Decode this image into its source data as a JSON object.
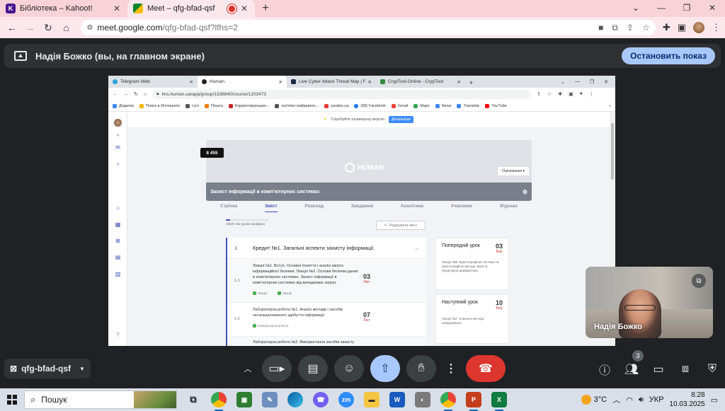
{
  "browser": {
    "tabs": [
      {
        "title": "Бібліотека – Kahoot!",
        "icon": "kahoot-icon",
        "color": "#46178f"
      },
      {
        "title": "Meet – qfg-bfad-qsf",
        "icon": "meet-icon",
        "active": true
      }
    ],
    "url_host": "meet.google.com",
    "url_path": "/qfg-bfad-qsf?lfhs=2"
  },
  "banner": {
    "text": "Надія Божко (вы, на главном экране)",
    "stop_label": "Остановить показ"
  },
  "shared": {
    "tabs": [
      "Telegram Web",
      "Human",
      "Live Cyber Attack Threat Map | R",
      "CrypTool-Online - CrypTool"
    ],
    "url": "lms.human.ua/app/group/1338840/course/1203473",
    "bookmarks": [
      "Додатки",
      "Поиск в Интернете",
      "гугл",
      "Пошта",
      "Корректирующая...",
      "summer-wallpapers...",
      "yandex.ua",
      "(58) Facebook",
      "Gmail",
      "Maps",
      "News",
      "Translate",
      "YouTube"
    ],
    "promo": "Спробуйте розширену версію",
    "promo_button": "Детальніше",
    "points": "8 455",
    "brand": "HUMAN",
    "rating_dropdown": "Оцінювання",
    "course_title": "Захист інформації в комп'ютерних системах",
    "course_tabs": [
      "Стрічка",
      "Зміст",
      "Розклад",
      "Завдання",
      "Аналітика",
      "Учасники",
      "Журнал"
    ],
    "progress_text": "10/20 тем уроків пройдено",
    "progress": 0.1,
    "edit_button": "Редагувати зміст",
    "credit_num": "1",
    "credit_title": "Кредит №1. Загальні аспекти захисту інформації.",
    "lessons": [
      {
        "num": "1.1",
        "text": "Лекція №1. Вступ. Основні поняття і аналіз загроз інформаційної безпеки. Лекція №2. Основи безпеки даних в комп'ютерних системах. Захист інформації в комп'ютерних системах від випадкових загроз",
        "tag1": "Лекція",
        "tag2": "Лекція",
        "day": "03",
        "month": "Лют"
      },
      {
        "num": "1.2",
        "text": "Лабораторна робота №1. Аналіз методів і засобів несанкціонованого здобуття інформації",
        "tag1": "Лабораторна робота",
        "tag2": "",
        "day": "07",
        "month": "Лют"
      },
      {
        "num": "1.3",
        "text": "Лабораторна робота №2. Використання засобів захисту",
        "tag1": "",
        "tag2": "",
        "day": "",
        "month": ""
      }
    ],
    "prev_card": {
      "title": "Попередній урок",
      "day": "03",
      "month": "Бер",
      "body": "Лекція №6. Криптографічні системи та криптографічні методи захисту. Модулярна арифметика."
    },
    "next_card": {
      "title": "Наступний урок",
      "day": "10",
      "month": "Бер",
      "body": "Лекція №7. Класичні методи шифрування."
    }
  },
  "self_tile": {
    "name": "Надія Божко"
  },
  "meet": {
    "code": "qfg-bfad-qsf",
    "participants": "3"
  },
  "taskbar": {
    "search_label": "Пошук",
    "weather": "3°C",
    "lang": "УКР",
    "time": "8:28",
    "date": "10.03.2025"
  }
}
